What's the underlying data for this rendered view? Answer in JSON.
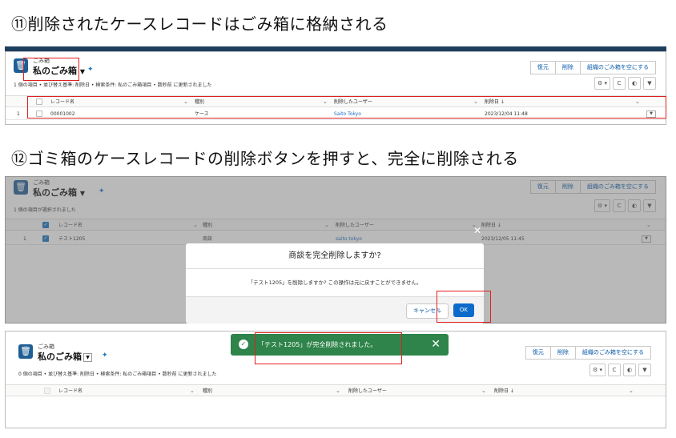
{
  "captions": {
    "step11": "⑪削除されたケースレコードはごみ箱に格納される",
    "step12": "⑫ゴミ箱のケースレコードの削除ボタンを押すと、完全に削除される"
  },
  "common": {
    "object_label": "ごみ箱",
    "list_title": "私のごみ箱",
    "buttons": [
      "復元",
      "削除",
      "組織のごみ箱を空にする"
    ],
    "icon_buttons": [
      "⚙ ▾",
      "C",
      "◐",
      "▼"
    ],
    "columns": [
      "レコード名",
      "種別",
      "削除したユーザー",
      "削除日 ↓"
    ],
    "columns_p1": [
      "レコード名",
      "種別",
      "削除したユーザー",
      "削除日 ↓"
    ]
  },
  "panel1": {
    "subtitle": "1 個の項目 • 並び替え基準: 削除日 • 検索条件: 私のごみ箱項目 • 数秒前 に更新されました",
    "row": {
      "num": "1",
      "name": "00001002",
      "type": "ケース",
      "user": "Saito Tokyo",
      "date": "2023/12/04 11:48"
    }
  },
  "panel2": {
    "subtitle": "1 個の項目が選択されました",
    "row": {
      "num": "1",
      "name": "テスト1205",
      "type": "商談",
      "user": "saito tokyo",
      "date": "2023/12/05 11:45"
    },
    "modal": {
      "title": "商談を完全削除しますか?",
      "body": "「テスト1205」を削除しますか? この操作は元に戻すことができません。",
      "cancel": "キャンセル",
      "ok": "OK"
    }
  },
  "panel3": {
    "subtitle": "0 個の項目 • 並び替え基準: 削除日 • 検索条件: 私のごみ箱項目 • 数秒前 に更新されました",
    "toast": "「テスト1205」が完全削除されました。"
  }
}
